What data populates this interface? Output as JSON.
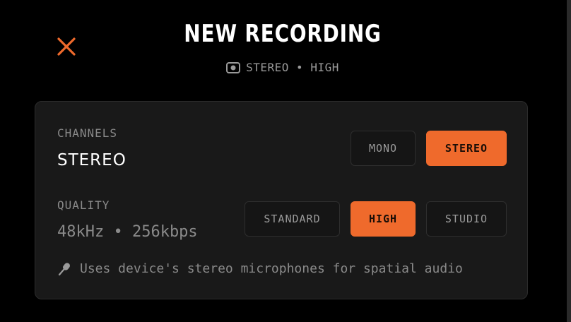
{
  "header": {
    "title": "NEW RECORDING",
    "subtitle": "STEREO • HIGH",
    "accent": "#ef6a2c",
    "close_icon": "close-icon",
    "subtitle_icon": "record-icon"
  },
  "channels": {
    "label": "CHANNELS",
    "value": "STEREO",
    "options": [
      "MONO",
      "STEREO"
    ],
    "selected": "STEREO"
  },
  "quality": {
    "label": "QUALITY",
    "value": "48kHz • 256kbps",
    "options": [
      "STANDARD",
      "HIGH",
      "STUDIO"
    ],
    "selected": "HIGH"
  },
  "hint": {
    "icon": "microphone-icon",
    "text": "Uses device's stereo microphones for spatial audio"
  }
}
